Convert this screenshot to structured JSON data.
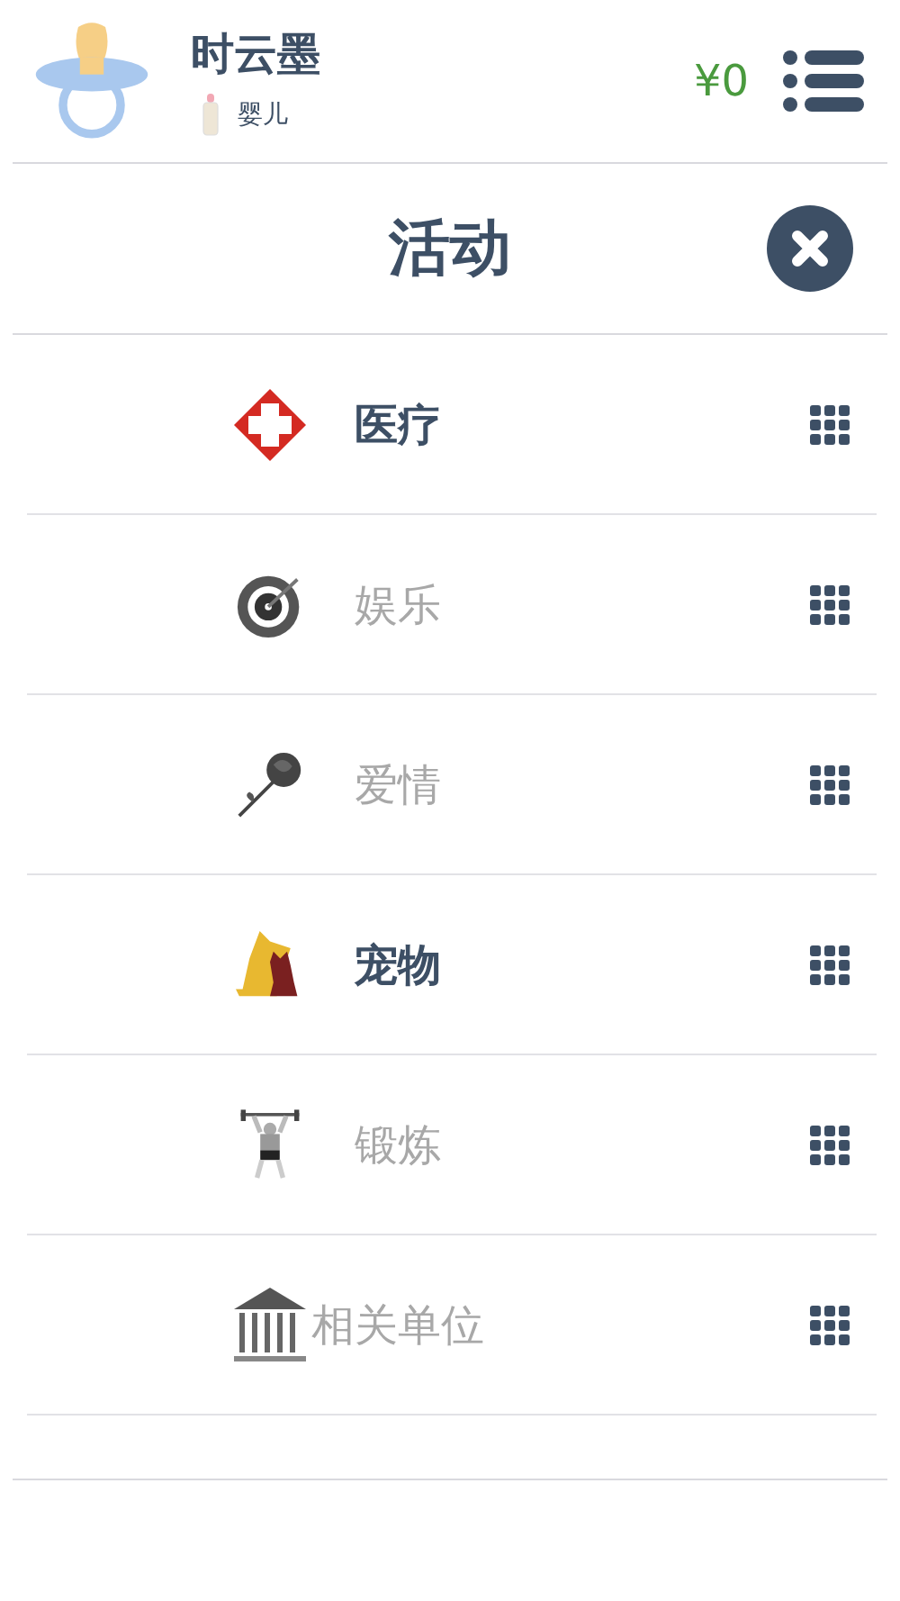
{
  "profile": {
    "name": "时云墨",
    "stage": "婴儿",
    "money": "¥0"
  },
  "panel": {
    "title": "活动"
  },
  "activities": [
    {
      "label": "医疗",
      "kind": "medical",
      "disabled": false
    },
    {
      "label": "娱乐",
      "kind": "target",
      "disabled": true
    },
    {
      "label": "爱情",
      "kind": "rose",
      "disabled": true
    },
    {
      "label": "宠物",
      "kind": "pet",
      "disabled": false
    },
    {
      "label": "锻炼",
      "kind": "weightlift",
      "disabled": true
    },
    {
      "label": "相关单位",
      "kind": "building",
      "disabled": true
    }
  ]
}
